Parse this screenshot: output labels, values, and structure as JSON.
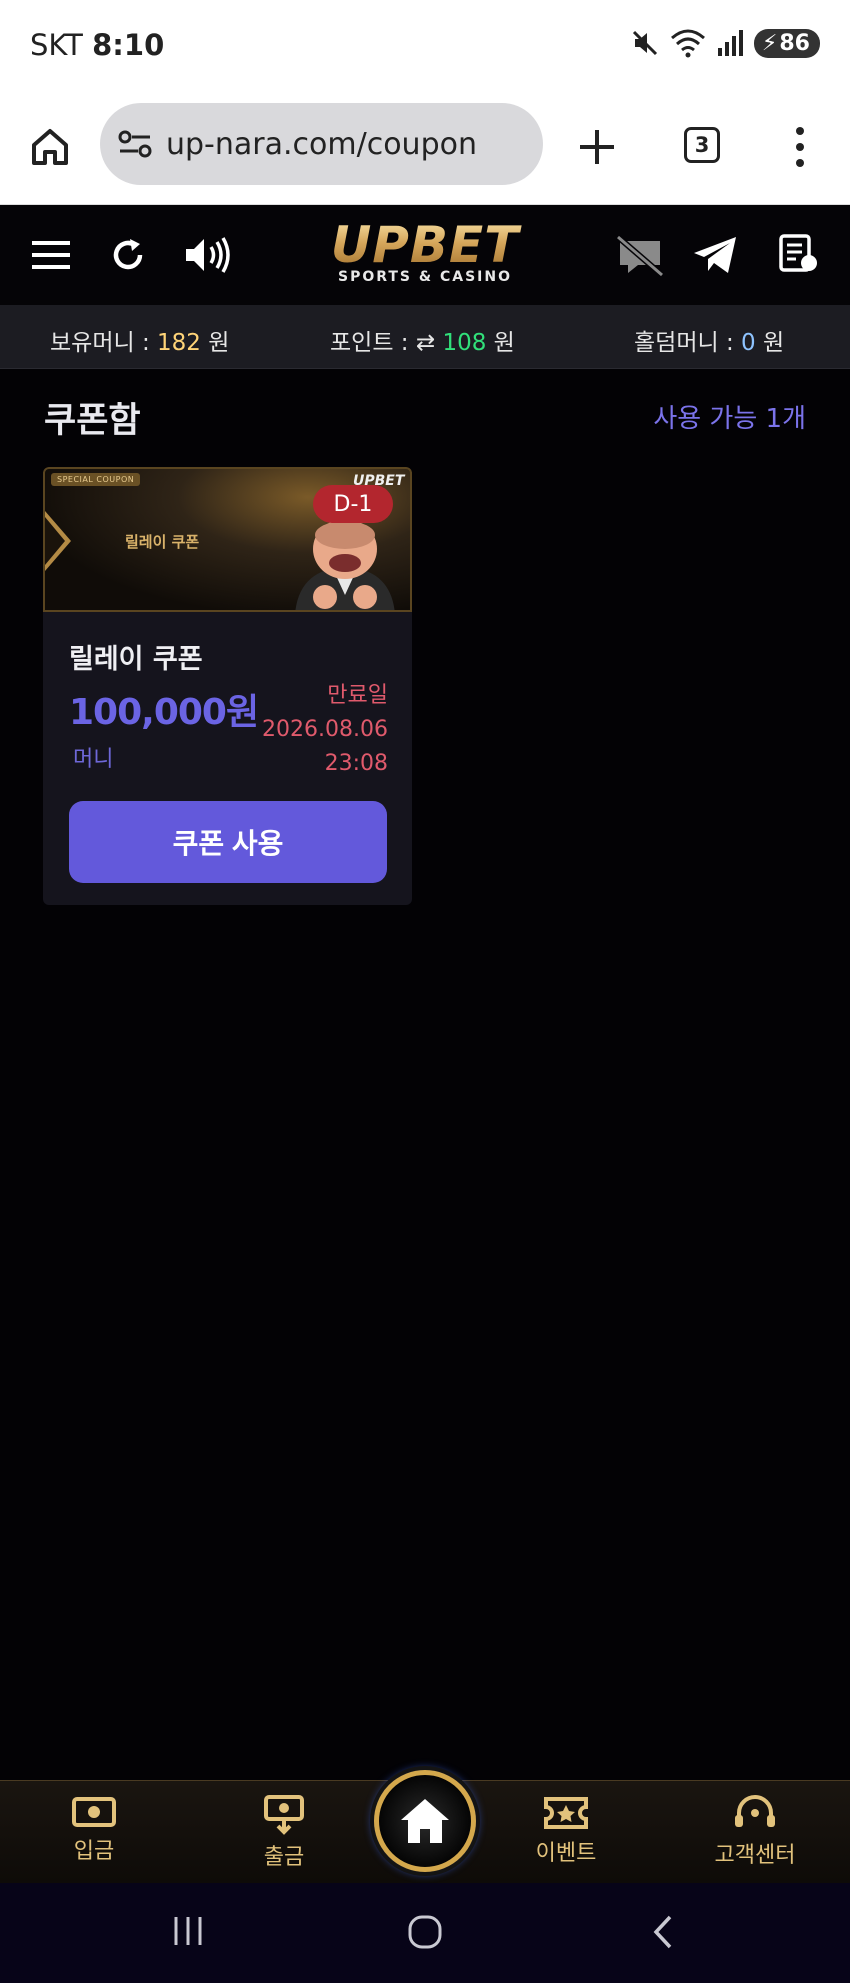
{
  "status_bar": {
    "carrier": "SKT",
    "time": "8:10",
    "battery": "86"
  },
  "browser": {
    "url": "up-nara.com/coupon",
    "tab_count": "3"
  },
  "header": {
    "logo": "UPBET",
    "logo_sub": "SPORTS & CASINO"
  },
  "money_bar": {
    "holding_label": "보유머니 : ",
    "holding_value": "182",
    "holding_unit": " 원",
    "point_label": "포인트 : ",
    "point_value": "108",
    "point_unit": " 원",
    "holdem_label": "홀덤머니 : ",
    "holdem_value": "0",
    "holdem_unit": " 원"
  },
  "content": {
    "title": "쿠폰함",
    "available": "사용 가능 1개"
  },
  "coupon": {
    "banner_tag": "SPECIAL COUPON",
    "banner_logo": "UPBET",
    "banner_name": "릴레이 쿠폰",
    "dday": "D-1",
    "name": "릴레이 쿠폰",
    "amount": "100,000원",
    "type": "머니",
    "expiry_label": "만료일",
    "expiry_date": "2026.08.06",
    "expiry_time": "23:08",
    "use_button": "쿠폰 사용"
  },
  "bottom_nav": {
    "deposit": "입금",
    "withdraw": "출금",
    "event": "이벤트",
    "support": "고객센터"
  },
  "colors": {
    "accent": "#6359db",
    "gold": "#d4a84c",
    "expiry": "#e05a6c"
  }
}
